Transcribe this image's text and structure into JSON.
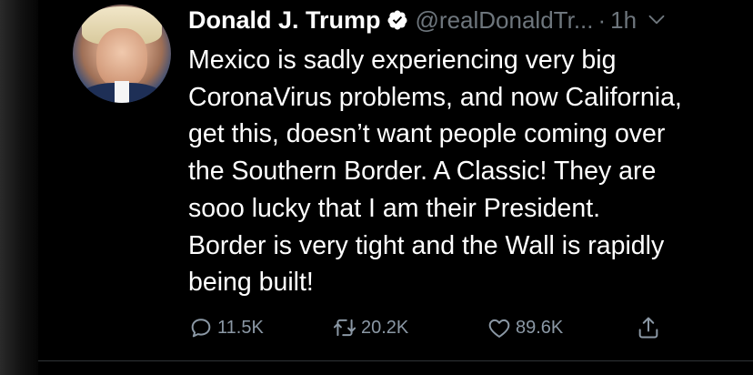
{
  "tweet": {
    "author": {
      "name": "Donald J. Trump",
      "handle": "@realDonaldTr...",
      "verified": true
    },
    "separator": "·",
    "time": "1h",
    "text_lines": [
      "Mexico is sadly experiencing very big",
      "CoronaVirus problems, and now California,",
      "get this, doesn’t want people coming over",
      "the Southern Border. A Classic! They are",
      "sooo lucky that I am their President.",
      "Border is very tight and the Wall is rapidly",
      "being built!"
    ],
    "actions": {
      "reply_count": "11.5K",
      "retweet_count": "20.2K",
      "like_count": "89.6K"
    }
  },
  "colors": {
    "background": "#000000",
    "primary_text": "#ffffff",
    "secondary_text": "#6e767d",
    "action_icon": "#8b98a5",
    "verified_badge": "#ffffff"
  },
  "icons": {
    "reply": "reply-icon",
    "retweet": "retweet-icon",
    "like": "like-icon",
    "share": "share-icon",
    "more": "chevron-down-icon",
    "verified": "verified-badge-icon"
  }
}
